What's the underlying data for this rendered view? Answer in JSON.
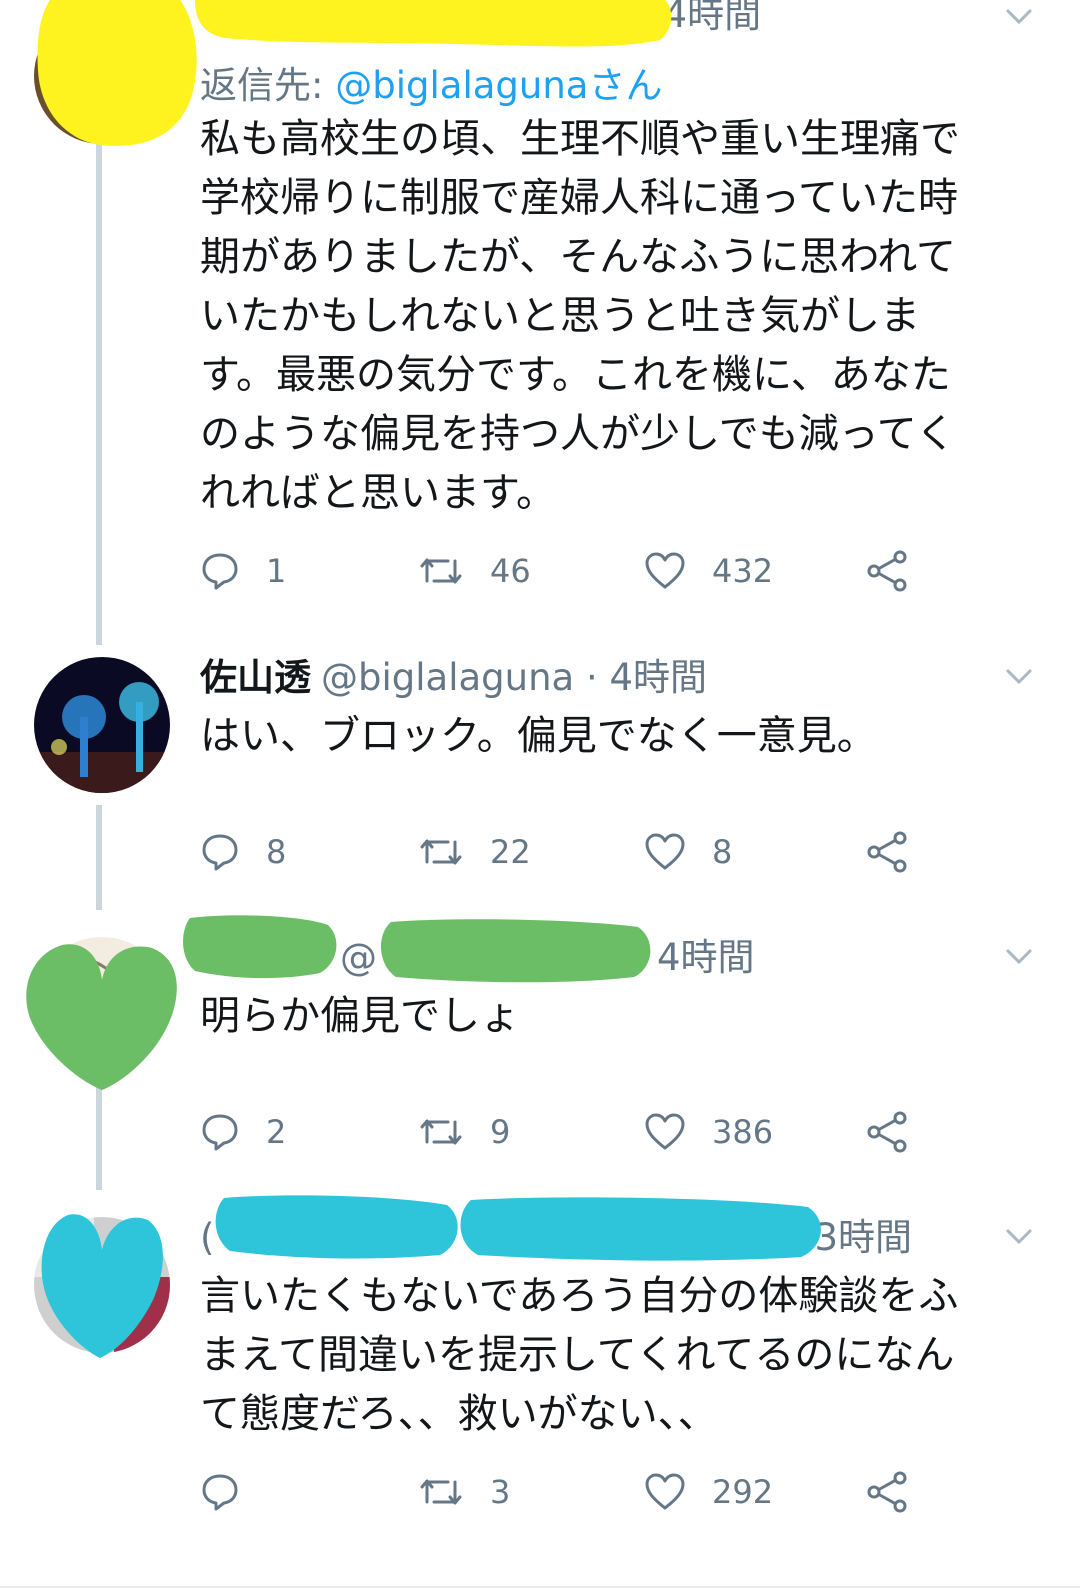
{
  "colors": {
    "text": "#14171a",
    "secondary": "#657786",
    "link": "#1da1f2",
    "thread_line": "#ccd6dd",
    "redact_yellow": "#fef31e",
    "redact_green": "#6bbd66",
    "redact_cyan": "#2ec5da"
  },
  "tweets": [
    {
      "handle_partial": "·",
      "time": "4時間",
      "reply_label": "返信先:",
      "reply_handle": "@biglalagunaさん",
      "text": "私も高校生の頃、生理不順や重い生理痛で\n学校帰りに制服で産婦人科に通っていた時\n期がありましたが、そんなふうに思われて\nいたかもしれないと思うと吐き気がしま\nす。最悪の気分です。これを機に、あなた\nのような偏見を持つ人が少しでも減ってく\nれればと思います。",
      "replies": "1",
      "retweets": "46",
      "likes": "432"
    },
    {
      "name": "佐山透",
      "handle": "@biglalaguna",
      "time": "· 4時間",
      "text": "はい、ブロック。偏見でなく一意見。",
      "replies": "8",
      "retweets": "22",
      "likes": "8"
    },
    {
      "handle_partial": "@",
      "time": "4時間",
      "text": "明らか偏見でしょ",
      "replies": "2",
      "retweets": "9",
      "likes": "386"
    },
    {
      "handle_partial": "(",
      "time": "3時間",
      "text": "言いたくもないであろう自分の体験談をふ\nまえて間違いを提示してくれてるのになん\nて態度だろ、、救いがない、、",
      "replies": "",
      "retweets": "3",
      "likes": "292"
    }
  ]
}
